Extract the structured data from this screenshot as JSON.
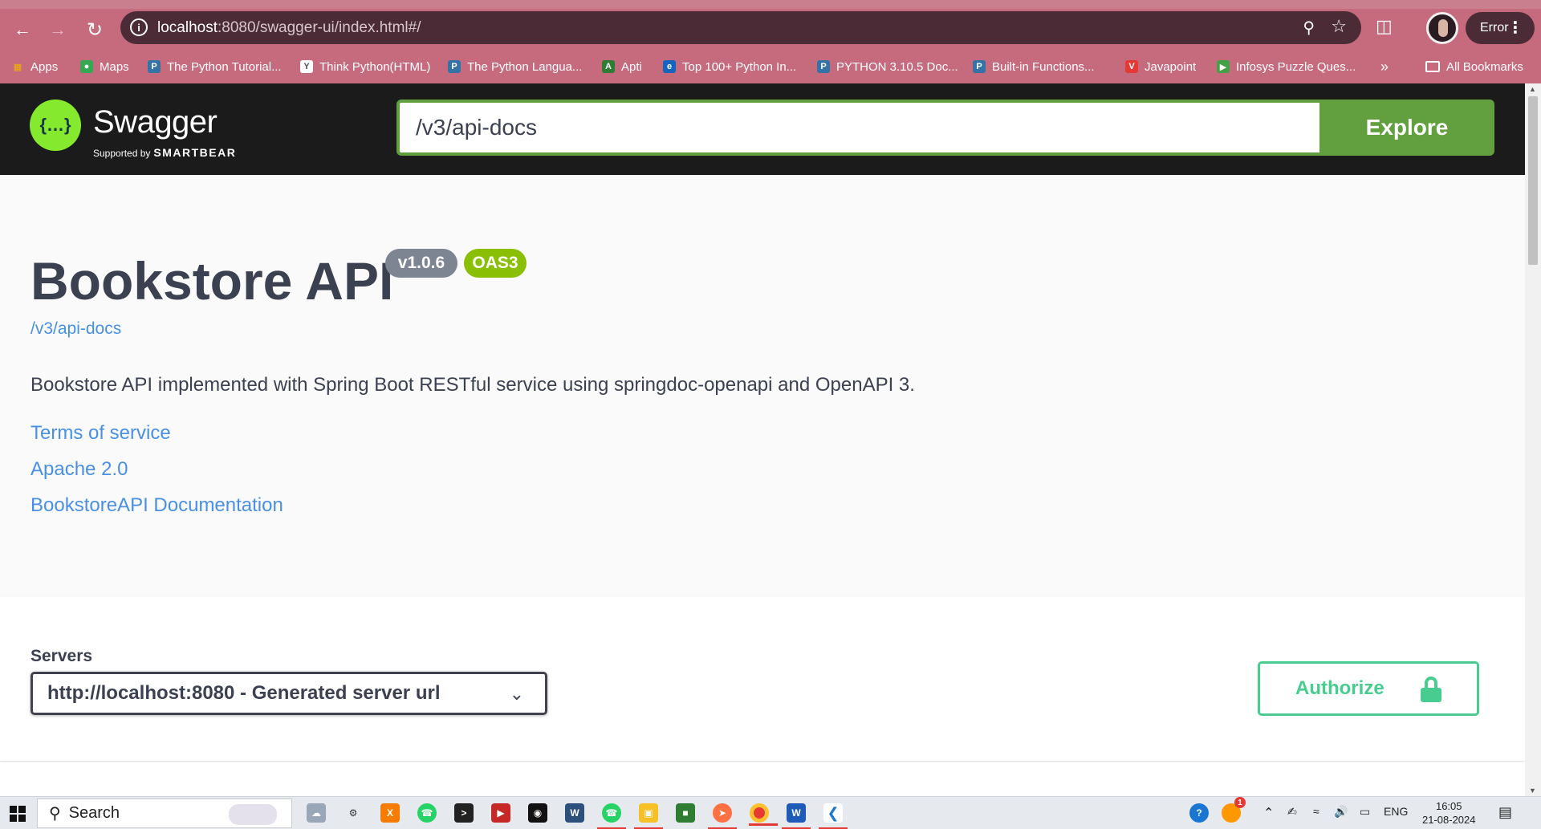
{
  "browser": {
    "url_host": "localhost",
    "url_rest": ":8080/swagger-ui/index.html#/",
    "profile_status": "Error",
    "bookmarks": [
      {
        "label": "Apps",
        "icon": "apps-grid-icon",
        "color": "#e8a13a"
      },
      {
        "label": "Maps",
        "icon": "maps-icon",
        "color": "#34a853"
      },
      {
        "label": "The Python Tutorial...",
        "icon": "python-icon",
        "color": "#3572a5"
      },
      {
        "label": "Think Python(HTML)",
        "icon": "book-icon",
        "color": "#ffffff"
      },
      {
        "label": "The Python Langua...",
        "icon": "python-icon",
        "color": "#3572a5"
      },
      {
        "label": "Apti",
        "icon": "apti-icon",
        "color": "#2e7d32"
      },
      {
        "label": "Top 100+ Python In...",
        "icon": "e-icon",
        "color": "#1565c0"
      },
      {
        "label": "PYTHON 3.10.5 Doc...",
        "icon": "python-icon",
        "color": "#3572a5"
      },
      {
        "label": "Built-in Functions...",
        "icon": "python-icon",
        "color": "#3572a5"
      },
      {
        "label": "Javapoint",
        "icon": "javapoint-icon",
        "color": "#e53935"
      },
      {
        "label": "Infosys Puzzle Ques...",
        "icon": "infosys-icon",
        "color": "#43a047"
      }
    ],
    "more_bookmarks": "»",
    "all_bookmarks": "All Bookmarks"
  },
  "swagger": {
    "brand": "Swagger",
    "supported_by": "Supported by",
    "smartbear": "SMARTBEAR",
    "search_value": "/v3/api-docs",
    "explore_label": "Explore",
    "logo_glyph": "{…}"
  },
  "info": {
    "title": "Bookstore API",
    "version": "v1.0.6",
    "oas": "OAS3",
    "spec_link": "/v3/api-docs",
    "description": "Bookstore API implemented with Spring Boot RESTful service using springdoc-openapi and OpenAPI 3.",
    "links": [
      "Terms of service",
      "Apache 2.0",
      "BookstoreAPI Documentation"
    ]
  },
  "servers": {
    "label": "Servers",
    "selected": "http://localhost:8080 - Generated server url",
    "authorize_label": "Authorize"
  },
  "taskbar": {
    "search_label": "Search",
    "language": "ENG",
    "time": "16:05",
    "date": "21-08-2024",
    "notification_badge": "1"
  },
  "colors": {
    "chrome": "#c56b7d",
    "swagger_green": "#62a03f",
    "authorize_green": "#49cc90",
    "link_blue": "#4990e2",
    "version_grey": "#7d8492",
    "oas_green": "#89bf04"
  }
}
